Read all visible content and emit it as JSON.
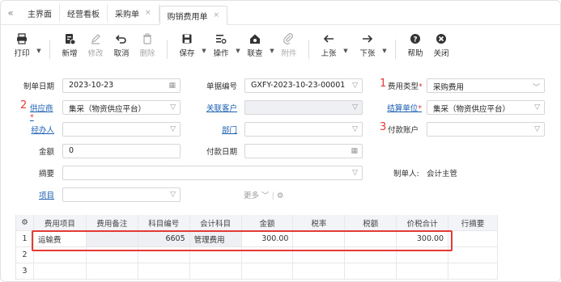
{
  "tabs": [
    {
      "label": "主界面",
      "closable": false,
      "active": false
    },
    {
      "label": "经营看板",
      "closable": false,
      "active": false
    },
    {
      "label": "采购单",
      "closable": true,
      "active": false
    },
    {
      "label": "购销费用单",
      "closable": true,
      "active": true
    }
  ],
  "toolbar": {
    "print": "打印",
    "new": "新增",
    "edit": "修改",
    "cancel": "取消",
    "delete": "删除",
    "save": "保存",
    "operate": "操作",
    "audit": "联查",
    "attach": "附件",
    "prev": "上张",
    "next": "下张",
    "help": "帮助",
    "close": "关闭"
  },
  "form": {
    "date_label": "制单日期",
    "date_value": "2023-10-23",
    "docno_label": "单据编号",
    "docno_value": "GXFY-2023-10-23-00001",
    "feetype_num": "1",
    "feetype_label": "费用类型",
    "feetype_value": "采购费用",
    "supplier_num": "2",
    "supplier_label": "供应商",
    "supplier_value": "集采（物资供应平台）",
    "customer_label": "关联客户",
    "settle_label": "结算单位",
    "settle_value": "集采（物资供应平台）",
    "handler_label": "经办人",
    "dept_label": "部门",
    "account_num": "3",
    "account_label": "付款账户",
    "amount_label": "金额",
    "amount_value": "0",
    "paydate_label": "付款日期",
    "summary_label": "摘要",
    "maker_label": "制单人:",
    "maker_value": "会计主管",
    "project_label": "项目",
    "more_label": "更多"
  },
  "grid": {
    "headers": [
      "费用项目",
      "费用备注",
      "科目编号",
      "会计科目",
      "金额",
      "税率",
      "税额",
      "价税合计",
      "行摘要"
    ],
    "rows": [
      {
        "no": "1",
        "item": "运输费",
        "remark": "",
        "code": "6605",
        "subject": "管理费用",
        "amount": "300.00",
        "rate": "",
        "tax": "",
        "total": "300.00",
        "memo": ""
      },
      {
        "no": "2",
        "item": "",
        "remark": "",
        "code": "",
        "subject": "",
        "amount": "",
        "rate": "",
        "tax": "",
        "total": "",
        "memo": ""
      },
      {
        "no": "3",
        "item": "",
        "remark": "",
        "code": "",
        "subject": "",
        "amount": "",
        "rate": "",
        "tax": "",
        "total": "",
        "memo": ""
      }
    ]
  },
  "colors": {
    "accent": "#e53935",
    "link": "#1a5fb4"
  }
}
